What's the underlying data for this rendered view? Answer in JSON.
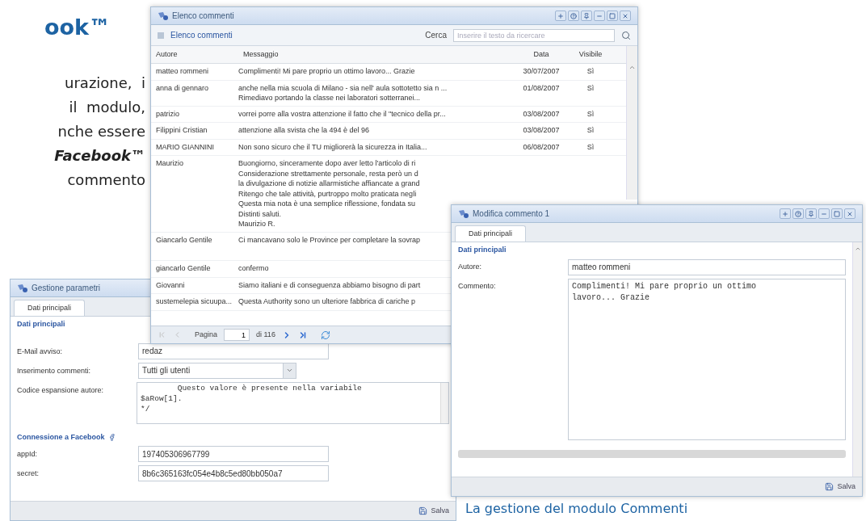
{
  "document": {
    "heading": "ook™",
    "lines": [
      {
        "text": "urazione,  i",
        "emphasis": false
      },
      {
        "text": "il  modulo,",
        "emphasis": false
      },
      {
        "text": "nche essere",
        "emphasis": false
      },
      {
        "text": "Facebook™",
        "emphasis": true
      },
      {
        "text": "commento",
        "emphasis": false
      }
    ],
    "caption": "La gestione del modulo Commenti"
  },
  "params_window": {
    "title": "Gestione parametri",
    "tabs": [
      {
        "label": "Dati principali",
        "selected": true
      }
    ],
    "section": "Dati principali",
    "fields": [
      {
        "kind": "text",
        "label": "E-Mail avviso:",
        "value": "redaz"
      },
      {
        "kind": "select",
        "label": "Inserimento commenti:",
        "value": "Tutti gli utenti"
      },
      {
        "kind": "code",
        "label": "Codice espansione autore:",
        "value": "        Questo valore è presente nella variabile\n$aRow[1].\n*/"
      }
    ],
    "facebook_section": "Connessione a Facebook",
    "facebook_fields": [
      {
        "kind": "text",
        "label": "appId:",
        "value": "197405306967799"
      },
      {
        "kind": "text",
        "label": "secret:",
        "value": "8b6c365163fc054e4b8c5ed80bb050a7"
      }
    ],
    "save": "Salva"
  },
  "comments_window": {
    "title": "Elenco commenti",
    "panel_title": "Elenco commenti",
    "search": {
      "label": "Cerca",
      "placeholder": "Inserire il testo da ricercare"
    },
    "columns": [
      "Autore",
      "Messaggio",
      "Data",
      "Visibile"
    ],
    "rows": [
      {
        "author": "matteo rommeni",
        "message": [
          "Complimenti! Mi pare proprio un ottimo lavoro... Grazie"
        ],
        "date": "30/07/2007",
        "visible": "Sì"
      },
      {
        "author": "anna di gennaro",
        "message": [
          "anche nella mia scuola di Milano - sia nell' aula sottotetto sia n ...",
          "Rimediavo portando la classe nei laboratori sotterranei..."
        ],
        "date": "01/08/2007",
        "visible": "Sì"
      },
      {
        "author": "patrizio",
        "message": [
          "vorrei porre alla vostra attenzione il fatto che il \"tecnico della pr..."
        ],
        "date": "03/08/2007",
        "visible": "Sì"
      },
      {
        "author": "Filippini Cristian",
        "message": [
          "attenzione alla svista che la 494 è del 96"
        ],
        "date": "03/08/2007",
        "visible": "Sì"
      },
      {
        "author": "MARIO GIANNINI",
        "message": [
          "Non sono sicuro che il TU migliorerà la sicurezza in Italia..."
        ],
        "date": "06/08/2007",
        "visible": "Sì"
      },
      {
        "author": "Maurizio",
        "message": [
          "Buongiorno, sinceramente dopo aver letto l'articolo di ri",
          "Considerazione strettamente personale, resta però un d",
          "la divulgazione di notizie allarmistiche affiancate a grand",
          "Ritengo che tale attività, purtroppo molto praticata negli",
          "Questa mia nota è una semplice riflessione, fondata su",
          "Distinti saluti.",
          "Maurizio R."
        ]
      },
      {
        "author": "Giancarlo Gentile",
        "message": [
          "Ci mancavano solo le Province per completare la sovrap"
        ]
      },
      {
        "author": "giancarlo Gentile",
        "message": [
          "confermo"
        ]
      },
      {
        "author": "Giovanni",
        "message": [
          "Siamo italiani e di conseguenza abbiamo bisogno di part"
        ]
      },
      {
        "author": "sustemelepia sicuupa...",
        "message": [
          "Questa Authority sono un ulteriore fabbrica di cariche p"
        ]
      }
    ],
    "pager": {
      "label": "Pagina",
      "page": "1",
      "total": "di 116"
    }
  },
  "edit_window": {
    "title": "Modifica commento 1",
    "tabs": [
      {
        "label": "Dati principali",
        "selected": true
      }
    ],
    "section": "Dati principali",
    "author_label": "Autore:",
    "author": "matteo rommeni",
    "comment_label": "Commento:",
    "comment": "Complimenti! Mi pare proprio un ottimo\nlavoro... Grazie",
    "save": "Salva"
  }
}
